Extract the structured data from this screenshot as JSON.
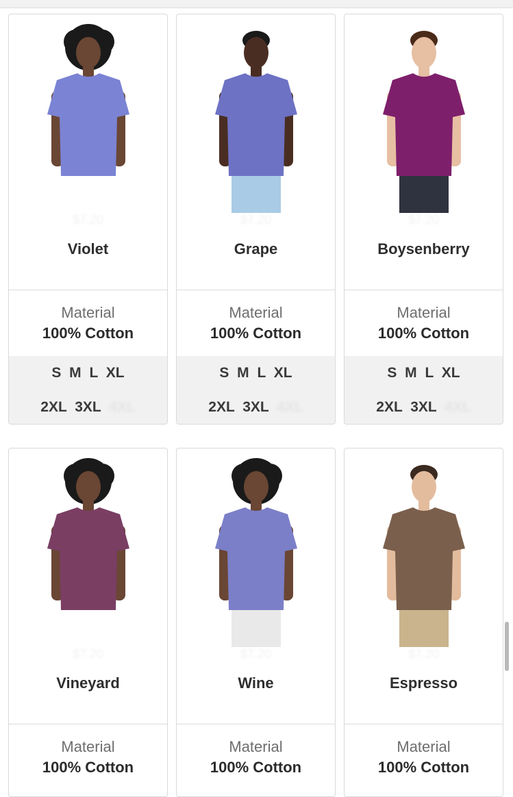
{
  "products": [
    {
      "name": "Violet",
      "price": "$7.20",
      "material_label": "Material",
      "material_value": "100% Cotton",
      "sizes_row1": "S M L XL",
      "sizes_row2": "2XL 3XL",
      "sizes_row2_extra": "4XL",
      "colors": {
        "shirt": "#7b83d4",
        "skin": "#6a4634",
        "hair": "#1a1a1a",
        "pants": "#ffffff"
      },
      "model": "female"
    },
    {
      "name": "Grape",
      "price": "$7.20",
      "material_label": "Material",
      "material_value": "100% Cotton",
      "sizes_row1": "S M L XL",
      "sizes_row2": "2XL 3XL",
      "sizes_row2_extra": "4XL",
      "colors": {
        "shirt": "#6d72c4",
        "skin": "#4a2d22",
        "hair": "#1a1a1a",
        "pants": "#a9cbe6"
      },
      "model": "male"
    },
    {
      "name": "Boysenberry",
      "price": "$7.20",
      "material_label": "Material",
      "material_value": "100% Cotton",
      "sizes_row1": "S M L XL",
      "sizes_row2": "2XL 3XL",
      "sizes_row2_extra": "4XL",
      "colors": {
        "shirt": "#7e1f6b",
        "skin": "#e7bfa3",
        "hair": "#4a2a18",
        "pants": "#2f3340"
      },
      "model": "male"
    },
    {
      "name": "Vineyard",
      "price": "$7.20",
      "material_label": "Material",
      "material_value": "100% Cotton",
      "colors": {
        "shirt": "#7a3e63",
        "skin": "#6a4634",
        "hair": "#1a1a1a",
        "pants": "#ffffff"
      },
      "model": "female"
    },
    {
      "name": "Wine",
      "price": "$7.20",
      "material_label": "Material",
      "material_value": "100% Cotton",
      "colors": {
        "shirt": "#7b7fc8",
        "skin": "#6a4634",
        "hair": "#1a1a1a",
        "pants": "#e9e9e9"
      },
      "model": "female"
    },
    {
      "name": "Espresso",
      "price": "$7.20",
      "material_label": "Material",
      "material_value": "100% Cotton",
      "colors": {
        "shirt": "#7a5f4d",
        "skin": "#e3bc9e",
        "hair": "#3a2a20",
        "pants": "#c9b48d"
      },
      "model": "male"
    }
  ]
}
